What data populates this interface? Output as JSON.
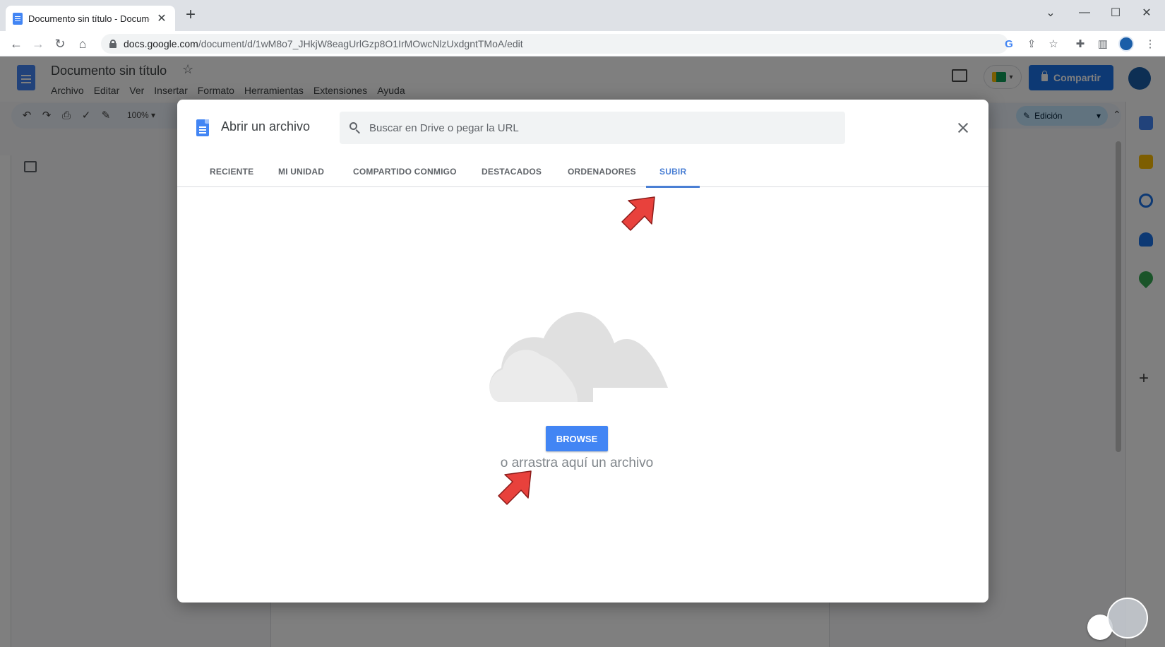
{
  "browser": {
    "tab_title": "Documento sin título - Documen",
    "url_host": "docs.google.com",
    "url_path": "/document/d/1wM8o7_JHkjW8eagUrlGzp8O1IrMOwcNlzUxdgntTMoA/edit"
  },
  "docs": {
    "title": "Documento sin título",
    "menu": [
      "Archivo",
      "Editar",
      "Ver",
      "Insertar",
      "Formato",
      "Herramientas",
      "Extensiones",
      "Ayuda"
    ],
    "share_label": "Compartir",
    "zoom": "100%",
    "mode_label": "Edición"
  },
  "dialog": {
    "title": "Abrir un archivo",
    "search_placeholder": "Buscar en Drive o pegar la URL",
    "tabs": [
      "RECIENTE",
      "MI UNIDAD",
      "COMPARTIDO CONMIGO",
      "DESTACADOS",
      "ORDENADORES",
      "SUBIR"
    ],
    "active_tab": "SUBIR",
    "browse_label": "BROWSE",
    "drop_text": "o arrastra aquí un archivo"
  },
  "colors": {
    "accent": "#4285f4",
    "active_tab": "#4a7fd4",
    "share_button": "#1a73e8",
    "arrow": "#e8413c"
  }
}
